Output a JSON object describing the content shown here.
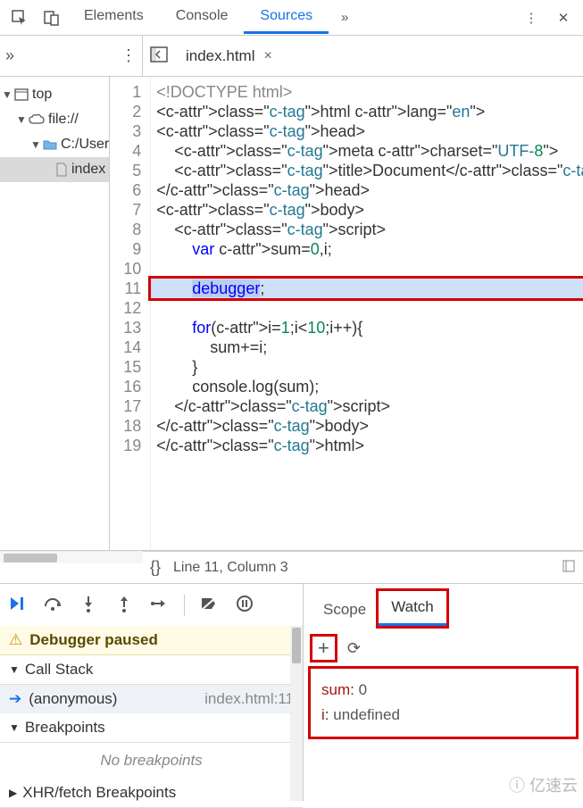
{
  "topTabs": {
    "elements": "Elements",
    "console": "Console",
    "sources": "Sources"
  },
  "fileTab": {
    "name": "index.html"
  },
  "tree": {
    "top": "top",
    "file": "file://",
    "folder": "C:/User",
    "doc": "index"
  },
  "code": {
    "lines": [
      "<!DOCTYPE html>",
      "<html lang=\"en\">",
      "<head>",
      "    <meta charset=\"UTF-8\">",
      "    <title>Document</title>",
      "</head>",
      "<body>",
      "    <script>",
      "        var sum=0,i;",
      "",
      "        debugger;",
      "",
      "        for(i=1;i<10;i++){",
      "            sum+=i;",
      "        }",
      "        console.log(sum);",
      "    </script>",
      "</body>",
      "</html>"
    ],
    "highlightLine": 11
  },
  "status": {
    "position": "Line 11, Column 3"
  },
  "scopeWatch": {
    "scope": "Scope",
    "watch": "Watch"
  },
  "pauseBanner": "Debugger paused",
  "panels": {
    "callStack": "Call Stack",
    "anonymous": "(anonymous)",
    "anonLoc": "index.html:11",
    "breakpoints": "Breakpoints",
    "noBreakpoints": "No breakpoints",
    "xhr": "XHR/fetch Breakpoints"
  },
  "watch": {
    "sumLabel": "sum",
    "sumValue": "0",
    "iLabel": "i",
    "iValue": "undefined"
  },
  "watermark": "亿速云"
}
